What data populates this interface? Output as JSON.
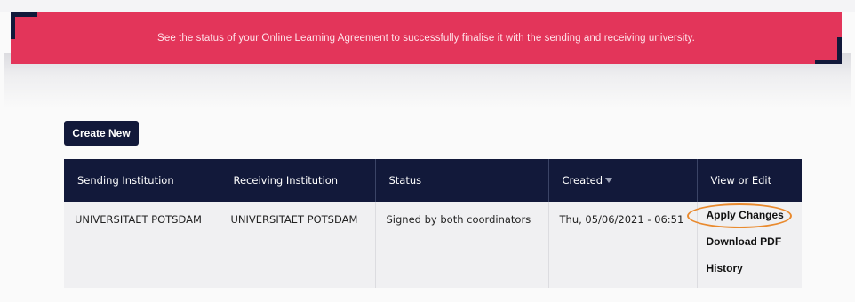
{
  "banner": {
    "message": "See the status of your Online Learning Agreement to successfully finalise it with the sending and receiving university.",
    "color": "#e3355a"
  },
  "toolbar": {
    "create_new_label": "Create New"
  },
  "table": {
    "headers": {
      "sending": "Sending Institution",
      "receiving": "Receiving Institution",
      "status": "Status",
      "created": "Created",
      "view_edit": "View or Edit"
    },
    "rows": [
      {
        "sending": "UNIVERSITAET POTSDAM",
        "receiving": "UNIVERSITAET POTSDAM",
        "status": "Signed by both coordinators",
        "created": "Thu, 05/06/2021 - 06:51",
        "actions": {
          "apply_changes": "Apply Changes",
          "download_pdf": "Download PDF",
          "history": "History"
        }
      }
    ]
  },
  "colors": {
    "header_bg": "#12193a",
    "highlight": "#e98a2e"
  }
}
